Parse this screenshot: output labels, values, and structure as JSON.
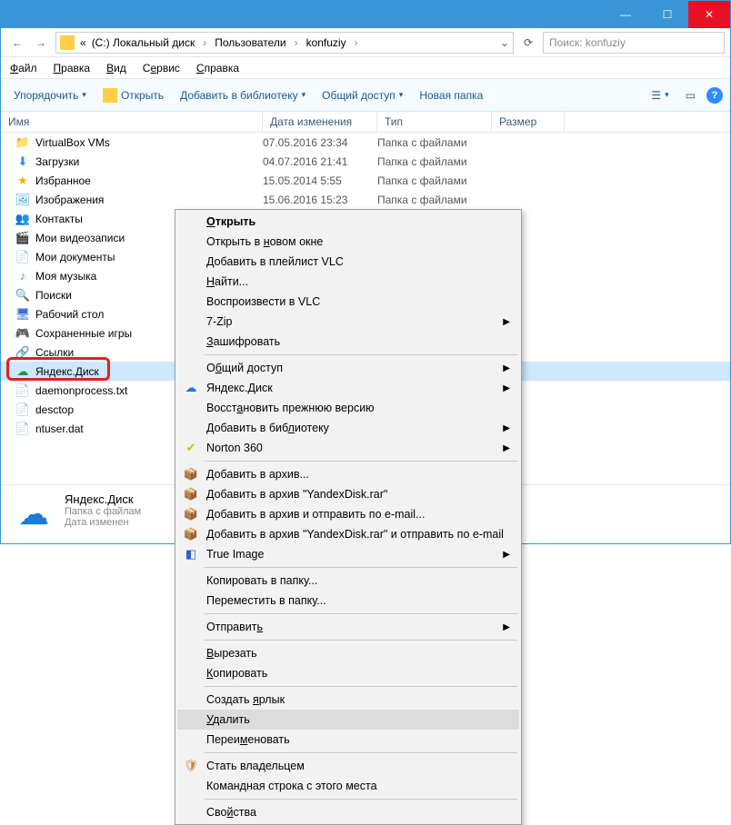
{
  "title_buttons": {
    "min": "—",
    "max": "☐",
    "close": "✕"
  },
  "address": {
    "back_icon": "←",
    "fwd_icon": "→",
    "nav_prefix": "«",
    "crumbs": [
      "(C:) Локальный диск",
      "Пользователи",
      "konfuziy"
    ],
    "refresh_icon": "⟳",
    "search_placeholder": "Поиск: konfuziy"
  },
  "menubar": [
    "Файл",
    "Правка",
    "Вид",
    "Сервис",
    "Справка"
  ],
  "toolbar": {
    "organize": "Упорядочить",
    "open": "Открыть",
    "addlib": "Добавить в библиотеку",
    "share": "Общий доступ",
    "newfolder": "Новая папка"
  },
  "columns": {
    "name": "Имя",
    "date": "Дата изменения",
    "type": "Тип",
    "size": "Размер"
  },
  "rows": [
    {
      "icon": "📁",
      "iconColor": "#ffcf48",
      "name": "VirtualBox VMs",
      "date": "07.05.2016 23:34",
      "type": "Папка с файлами"
    },
    {
      "icon": "⬇",
      "iconColor": "#2d8cff",
      "name": "Загрузки",
      "date": "04.07.2016 21:41",
      "type": "Папка с файлами"
    },
    {
      "icon": "★",
      "iconColor": "#f2b200",
      "name": "Избранное",
      "date": "15.05.2014 5:55",
      "type": "Папка с файлами"
    },
    {
      "icon": "🖼",
      "iconColor": "#36a2d0",
      "name": "Изображения",
      "date": "15.06.2016 15:23",
      "type": "Папка с файлами"
    },
    {
      "icon": "👥",
      "iconColor": "#3aa04a",
      "name": "Контакты",
      "date": "",
      "type": ""
    },
    {
      "icon": "🎬",
      "iconColor": "#3a6fcc",
      "name": "Мои видеозаписи",
      "date": "",
      "type": ""
    },
    {
      "icon": "📄",
      "iconColor": "#6aa84f",
      "name": "Мои документы",
      "date": "",
      "type": ""
    },
    {
      "icon": "♪",
      "iconColor": "#1aa6c9",
      "name": "Моя музыка",
      "date": "",
      "type": ""
    },
    {
      "icon": "🔍",
      "iconColor": "#808080",
      "name": "Поиски",
      "date": "",
      "type": ""
    },
    {
      "icon": "🖥",
      "iconColor": "#3a6fcc",
      "name": "Рабочий стол",
      "date": "",
      "type": ""
    },
    {
      "icon": "🎮",
      "iconColor": "#6aa84f",
      "name": "Сохраненные игры",
      "date": "",
      "type": ""
    },
    {
      "icon": "🔗",
      "iconColor": "#6aa84f",
      "name": "Ссылки",
      "date": "",
      "type": ""
    },
    {
      "icon": "☁",
      "iconColor": "#1a9c3e",
      "name": "Яндекс.Диск",
      "date": "",
      "type": "",
      "selected": true
    },
    {
      "icon": "📄",
      "iconColor": "#aaaaaa",
      "name": "daemonprocess.txt",
      "date": "",
      "type": ""
    },
    {
      "icon": "📄",
      "iconColor": "#aaaaaa",
      "name": "desctop",
      "date": "",
      "type": ""
    },
    {
      "icon": "📄",
      "iconColor": "#aaaaaa",
      "name": "ntuser.dat",
      "date": "",
      "type": ""
    }
  ],
  "details": {
    "title": "Яндекс.Диск",
    "sub1": "Папка с файлам",
    "sub2": "Дата изменен"
  },
  "context": {
    "groups": [
      [
        {
          "html": "<b><u>О</u>ткрыть</b>"
        },
        {
          "html": "Открыть в <u>н</u>овом окне"
        },
        {
          "html": "Добавить в плейлист VLC"
        },
        {
          "html": "<u>Н</u>айти..."
        },
        {
          "html": "Воспроизвести в VLC"
        },
        {
          "html": "7-Zip",
          "arrow": true
        },
        {
          "html": "<u>З</u>ашифровать"
        }
      ],
      [
        {
          "html": "О<u>б</u>щий доступ",
          "arrow": true
        },
        {
          "html": "Яндекс.Диск",
          "arrow": true,
          "icon": "☁",
          "iconColor": "#1a7bd8"
        },
        {
          "html": "Восст<u>а</u>новить прежнюю версию"
        },
        {
          "html": "Добавить в биб<u>л</u>иотеку",
          "arrow": true
        },
        {
          "html": "Norton 360",
          "arrow": true,
          "icon": "✔",
          "iconColor": "#e0b000"
        }
      ],
      [
        {
          "html": "Добавить в архив...",
          "icon": "📦",
          "iconColor": "#a05a2c"
        },
        {
          "html": "Добавить в архив \"YandexDisk.rar\"",
          "icon": "📦",
          "iconColor": "#a05a2c"
        },
        {
          "html": "Добавить в архив и отправить по e-mail...",
          "icon": "📦",
          "iconColor": "#a05a2c"
        },
        {
          "html": "Добавить в архив \"YandexDisk.rar\" и отправить по e-mail",
          "icon": "📦",
          "iconColor": "#a05a2c"
        },
        {
          "html": "True Image",
          "arrow": true,
          "icon": "◧",
          "iconColor": "#2d5fd0"
        }
      ],
      [
        {
          "html": "Копировать в папку..."
        },
        {
          "html": "Переместить в папку..."
        }
      ],
      [
        {
          "html": "Отправит<u>ь</u>",
          "arrow": true
        }
      ],
      [
        {
          "html": "<u>В</u>ырезать"
        },
        {
          "html": "<u>К</u>опировать"
        }
      ],
      [
        {
          "html": "Создать <u>я</u>рлык"
        },
        {
          "html": "<u>У</u>далить",
          "highlight": true
        },
        {
          "html": "Переи<u>м</u>еновать"
        }
      ],
      [
        {
          "html": "Стать владельцем",
          "icon": "🛡",
          "iconColor": "#c08a2e"
        },
        {
          "html": "Командная строка с этого места"
        }
      ],
      [
        {
          "html": "Сво<u>й</u>ства"
        }
      ]
    ]
  }
}
